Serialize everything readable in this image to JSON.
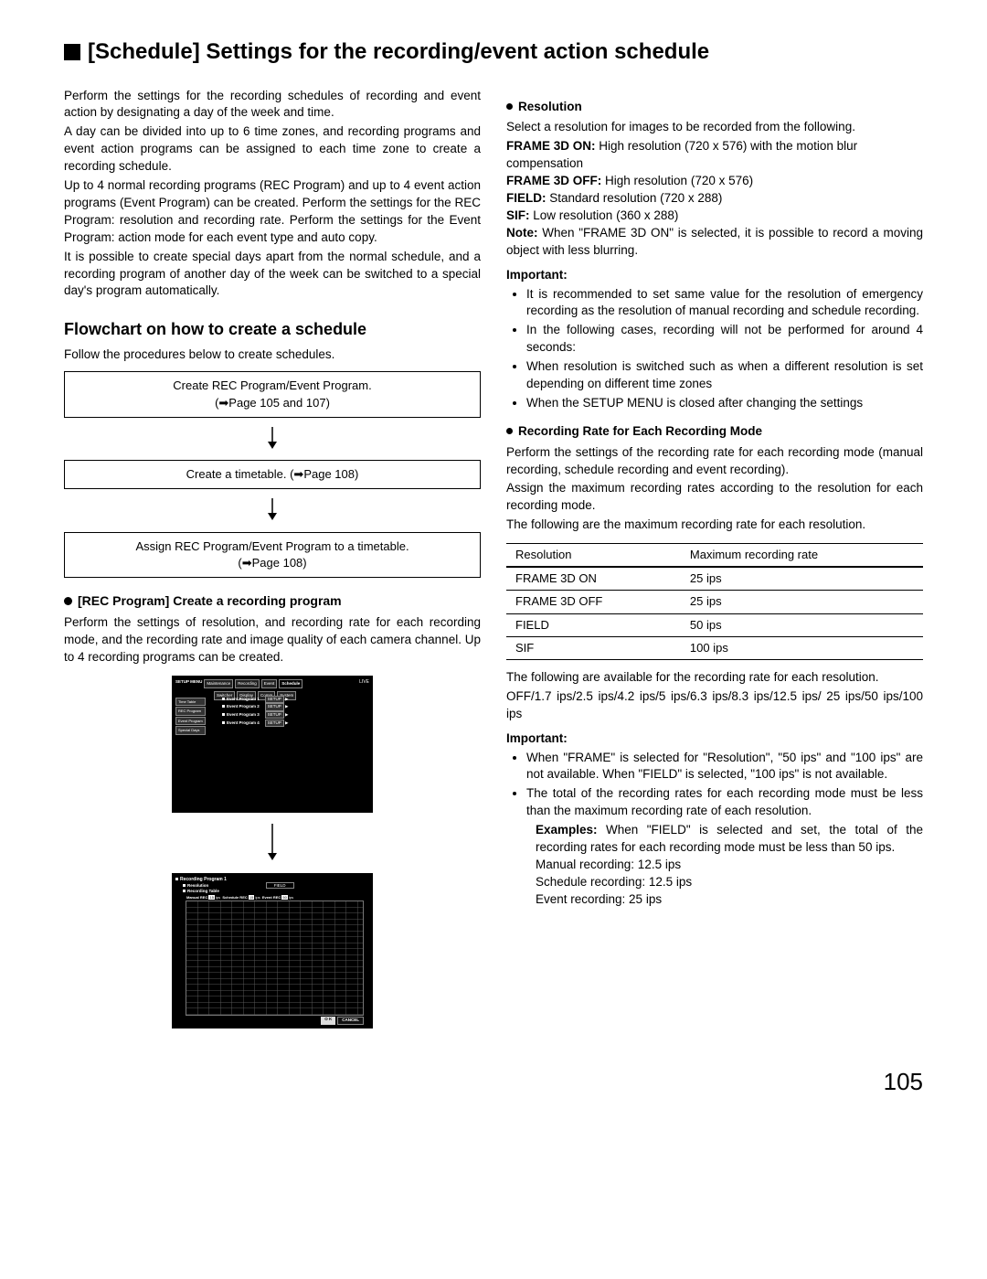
{
  "title": "[Schedule] Settings for the recording/event action schedule",
  "intro": {
    "p1": "Perform the settings for the recording schedules of recording and event action by designating a day of the week and time.",
    "p2": "A day can be divided into up to 6 time zones, and recording programs and event action programs can be assigned to each time zone to create a recording schedule.",
    "p3": "Up to 4 normal recording programs (REC Program) and up to 4 event action programs (Event Program) can be created. Perform the settings for the REC Program: resolution and recording rate. Perform the settings for the Event Program: action mode for each event type and auto copy.",
    "p4": "It is possible to create special days apart from the normal schedule, and a recording program of another day of the week can be switched to a special day's program automatically."
  },
  "flowchart": {
    "heading": "Flowchart on how to create a schedule",
    "lead": "Follow the procedures below to create schedules.",
    "box1a": "Create REC Program/Event Program.",
    "box1b": "(➡Page 105 and 107)",
    "box2": "Create a timetable. (➡Page 108)",
    "box3a": "Assign REC Program/Event Program to a timetable.",
    "box3b": "(➡Page 108)"
  },
  "rec_program": {
    "heading": "[REC Program] Create a recording program",
    "body": "Perform the settings of resolution, and recording rate for each recording mode, and the recording rate and image quality of each camera channel. Up to 4 recording programs can be created."
  },
  "shot1": {
    "menu": "SETUP MENU",
    "tabs": [
      "Maintenance",
      "Recording",
      "Event",
      "Schedule"
    ],
    "tabs2": [
      "Switcher",
      "Display",
      "Comm",
      "System"
    ],
    "live": "LIVE",
    "side": [
      "Time Table",
      "REC Program",
      "Event Program",
      "Special Days"
    ],
    "items": [
      "Event Program 1",
      "Event Program 2",
      "Event Program 3",
      "Event Program 4"
    ],
    "setup": "SETUP"
  },
  "shot2": {
    "title1": "Recording Program 1",
    "title2": "Resolution",
    "res": "FIELD",
    "title3": "Recording Table",
    "header_manual": "Manual REC",
    "header_sched": "Schedule REC",
    "header_event": "Event REC",
    "val1": "15",
    "unit": "ips",
    "val2": "15",
    "val3": "50",
    "ok": "O K",
    "cancel": "CANCEL"
  },
  "resolution": {
    "heading": "Resolution",
    "lead": "Select a resolution for images to be recorded from the following.",
    "opts": [
      {
        "k": "FRAME 3D ON:",
        "v": "High resolution (720 x 576) with the motion blur compensation"
      },
      {
        "k": "FRAME 3D OFF:",
        "v": "High resolution (720 x 576)"
      },
      {
        "k": "FIELD:",
        "v": "Standard resolution (720 x 288)"
      },
      {
        "k": "SIF:",
        "v": "Low resolution (360 x 288)"
      }
    ],
    "note_label": "Note:",
    "note": "When \"FRAME 3D ON\" is selected, it is possible to record a moving object with less blurring.",
    "important_label": "Important:",
    "bullets": [
      "It is recommended to set same value for the resolution of emergency recording as the resolution of manual recording and schedule recording.",
      "In the following cases, recording will not be performed for around 4 seconds:",
      "When resolution is switched such as when a different resolution is set depending on different time zones",
      "When the SETUP MENU is closed after changing the settings"
    ]
  },
  "rate": {
    "heading": "Recording Rate for Each Recording Mode",
    "p1": "Perform the settings of the recording rate for each recording mode (manual recording, schedule recording and event recording).",
    "p2": "Assign the maximum recording rates according to the resolution for each recording mode.",
    "p3": "The following are the maximum recording rate for each resolution.",
    "th1": "Resolution",
    "th2": "Maximum recording rate",
    "rows": [
      {
        "r": "FRAME 3D ON",
        "v": "25 ips"
      },
      {
        "r": "FRAME 3D OFF",
        "v": "25 ips"
      },
      {
        "r": "FIELD",
        "v": "50 ips"
      },
      {
        "r": "SIF",
        "v": "100 ips"
      }
    ],
    "after1": "The following are available for the recording rate for each resolution.",
    "after2": "OFF/1.7 ips/2.5 ips/4.2 ips/5 ips/6.3 ips/8.3 ips/12.5 ips/ 25 ips/50 ips/100 ips",
    "important_label": "Important:",
    "b1": "When \"FRAME\" is selected for \"Resolution\", \"50 ips\" and \"100 ips\" are not available. When \"FIELD\" is selected, \"100 ips\" is not available.",
    "b2": "The total of the recording rates for each recording mode must be less than the maximum recording rate of each resolution.",
    "ex_label": "Examples:",
    "ex_body": "When \"FIELD\" is selected and set, the total of the recording rates for each recording mode must be less than 50 ips.",
    "ex_l1": "Manual recording: 12.5 ips",
    "ex_l2": "Schedule recording: 12.5 ips",
    "ex_l3": "Event recording: 25 ips"
  },
  "page": "105"
}
